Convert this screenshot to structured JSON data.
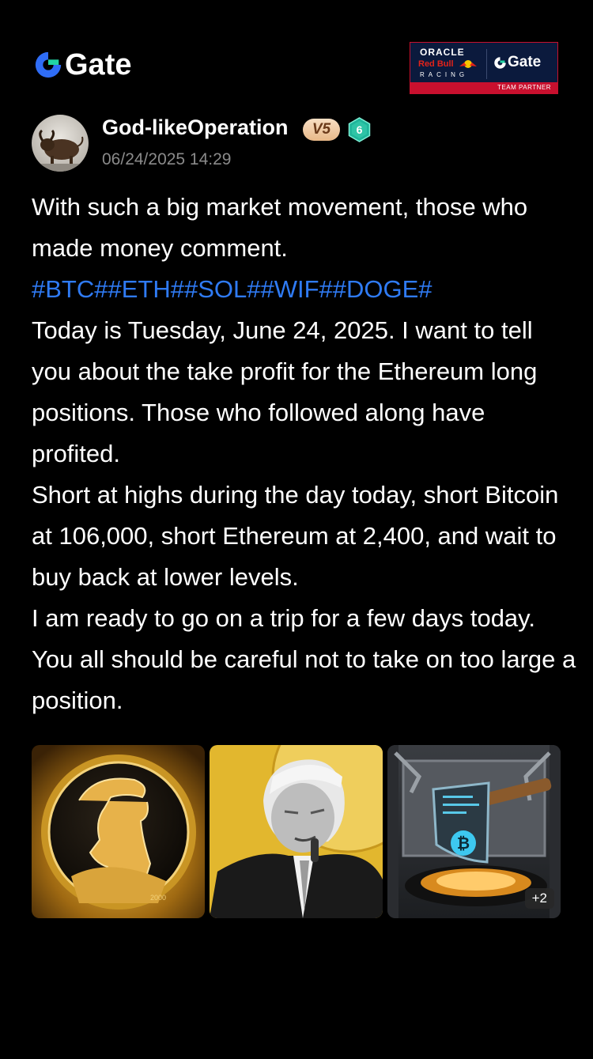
{
  "header": {
    "brand": "Gate",
    "partner": {
      "oracle": "ORACLE",
      "redbull": "Red Bull",
      "racing": "RACING",
      "gate": "Gate",
      "team_partner": "TEAM PARTNER"
    }
  },
  "post": {
    "author": "God-likeOperation",
    "vip_badge": "V5",
    "level_badge": "6",
    "timestamp": "06/24/2025 14:29",
    "line1": "With such a big market movement, those who made money comment.",
    "hashtags": "#BTC##ETH##SOL##WIF##DOGE#",
    "paragraph2": "Today is Tuesday, June 24, 2025. I want to tell you about the take profit for the Ethereum long positions. Those who followed along have profited.",
    "paragraph3": "Short at highs during the day today, short Bitcoin at 106,000, short Ethereum at 2,400, and wait to buy back at lower levels.",
    "paragraph4": "I am ready to go on a trip for a few days today. You all should be careful not to take on too large a position.",
    "more_images": "+2"
  },
  "colors": {
    "background": "#000000",
    "hashtag": "#2f7bf5",
    "timestamp": "#8a8a8a",
    "vip_badge": "#f2cfa6",
    "level_badge": "#2ec4a6"
  }
}
